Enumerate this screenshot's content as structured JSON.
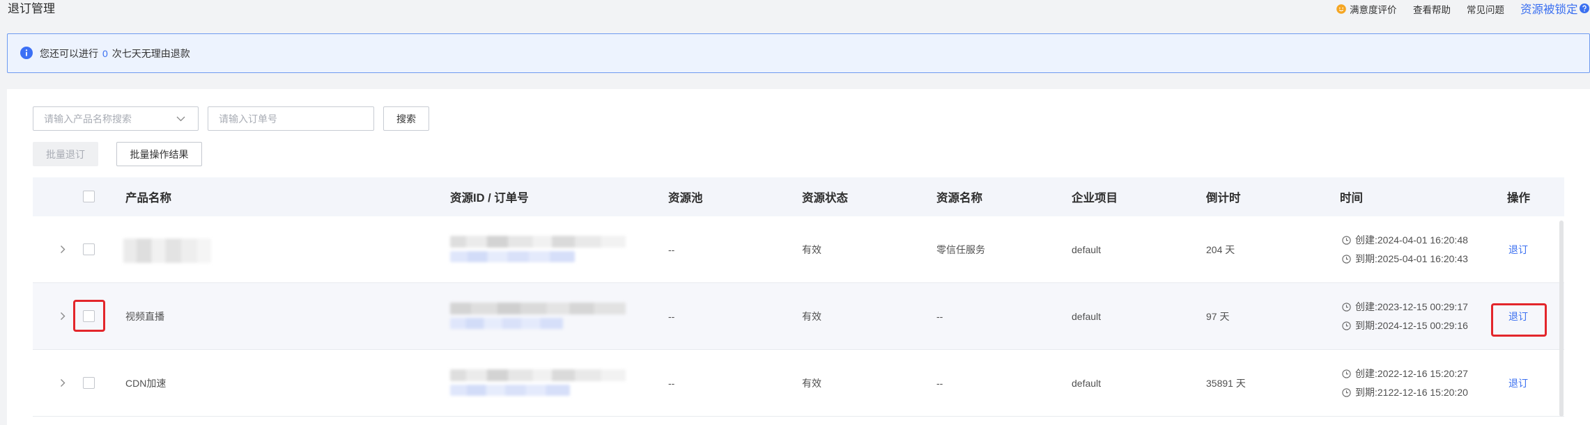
{
  "page": {
    "title": "退订管理"
  },
  "header_links": {
    "satisfaction": "满意度评价",
    "help": "查看帮助",
    "faq": "常见问题",
    "resource_locked": "资源被锁定"
  },
  "notice": {
    "prefix": "您还可以进行",
    "count": "0",
    "suffix": "次七天无理由退款"
  },
  "filters": {
    "product_placeholder": "请输入产品名称搜索",
    "order_placeholder": "请输入订单号",
    "search_label": "搜索"
  },
  "bulk_actions": {
    "unsubscribe_label": "批量退订",
    "results_label": "批量操作结果"
  },
  "table": {
    "columns": {
      "product_name": "产品名称",
      "resource_id": "资源ID / 订单号",
      "pool": "资源池",
      "status": "资源状态",
      "resource_name": "资源名称",
      "project": "企业项目",
      "countdown": "倒计时",
      "time": "时间",
      "action": "操作"
    },
    "rows": [
      {
        "pool": "--",
        "status": "有效",
        "resource_name": "零信任服务",
        "project": "default",
        "countdown": "204 天",
        "created": "创建:2024-04-01 16:20:48",
        "expires": "到期:2025-04-01 16:20:43",
        "action": "退订"
      },
      {
        "product_name": "视频直播",
        "pool": "--",
        "status": "有效",
        "resource_name": "--",
        "project": "default",
        "countdown": "97 天",
        "created": "创建:2023-12-15 00:29:17",
        "expires": "到期:2024-12-15 00:29:16",
        "action": "退订"
      },
      {
        "product_name": "CDN加速",
        "pool": "--",
        "status": "有效",
        "resource_name": "--",
        "project": "default",
        "countdown": "35891 天",
        "created": "创建:2022-12-16 15:20:27",
        "expires": "到期:2122-12-16 15:20:20",
        "action": "退订"
      }
    ]
  },
  "colors": {
    "accent": "#3a6ff0",
    "highlight": "#e3262b",
    "page_background": "#f2f3f5"
  },
  "icons": {
    "satisfaction": "smiley-icon",
    "resource_locked_help": "question-circle-icon",
    "notice": "info-icon",
    "product_select": "chevron-down-icon",
    "row_expand": "chevron-right-icon",
    "time": "clock-icon"
  }
}
